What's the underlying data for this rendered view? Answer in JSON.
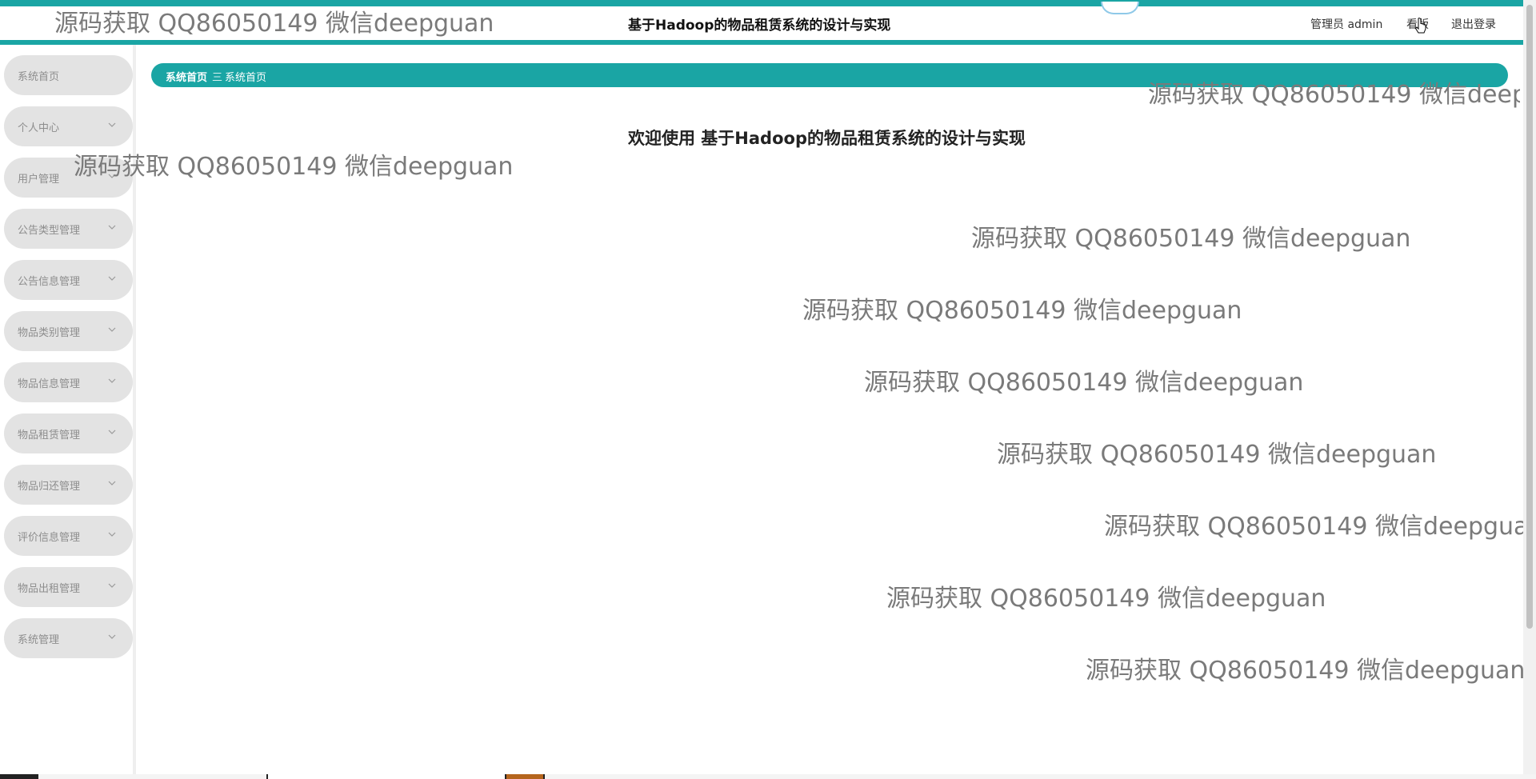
{
  "header": {
    "title": "基于Hadoop的物品租赁系统的设计与实现",
    "admin_label": "管理员 admin",
    "frontend_link": "看版",
    "logout_link": "退出登录"
  },
  "sidebar": {
    "items": [
      {
        "label": "系统首页",
        "has_chevron": false
      },
      {
        "label": "个人中心",
        "has_chevron": true
      },
      {
        "label": "用户管理",
        "has_chevron": true
      },
      {
        "label": "公告类型管理",
        "has_chevron": true
      },
      {
        "label": "公告信息管理",
        "has_chevron": true
      },
      {
        "label": "物品类别管理",
        "has_chevron": true
      },
      {
        "label": "物品信息管理",
        "has_chevron": true
      },
      {
        "label": "物品租赁管理",
        "has_chevron": true
      },
      {
        "label": "物品归还管理",
        "has_chevron": true
      },
      {
        "label": "评价信息管理",
        "has_chevron": true
      },
      {
        "label": "物品出租管理",
        "has_chevron": true
      },
      {
        "label": "系统管理",
        "has_chevron": true
      }
    ]
  },
  "breadcrumb": {
    "home": "系统首页",
    "separator": "三",
    "current": "系统首页"
  },
  "main": {
    "welcome": "欢迎使用 基于Hadoop的物品租赁系统的设计与实现"
  },
  "watermark_text": "源码获取 QQ86050149 微信deepguan",
  "colors": {
    "accent": "#1aa5a4",
    "nav_bg": "#e3e3e3",
    "nav_text": "#8d8d8d"
  }
}
